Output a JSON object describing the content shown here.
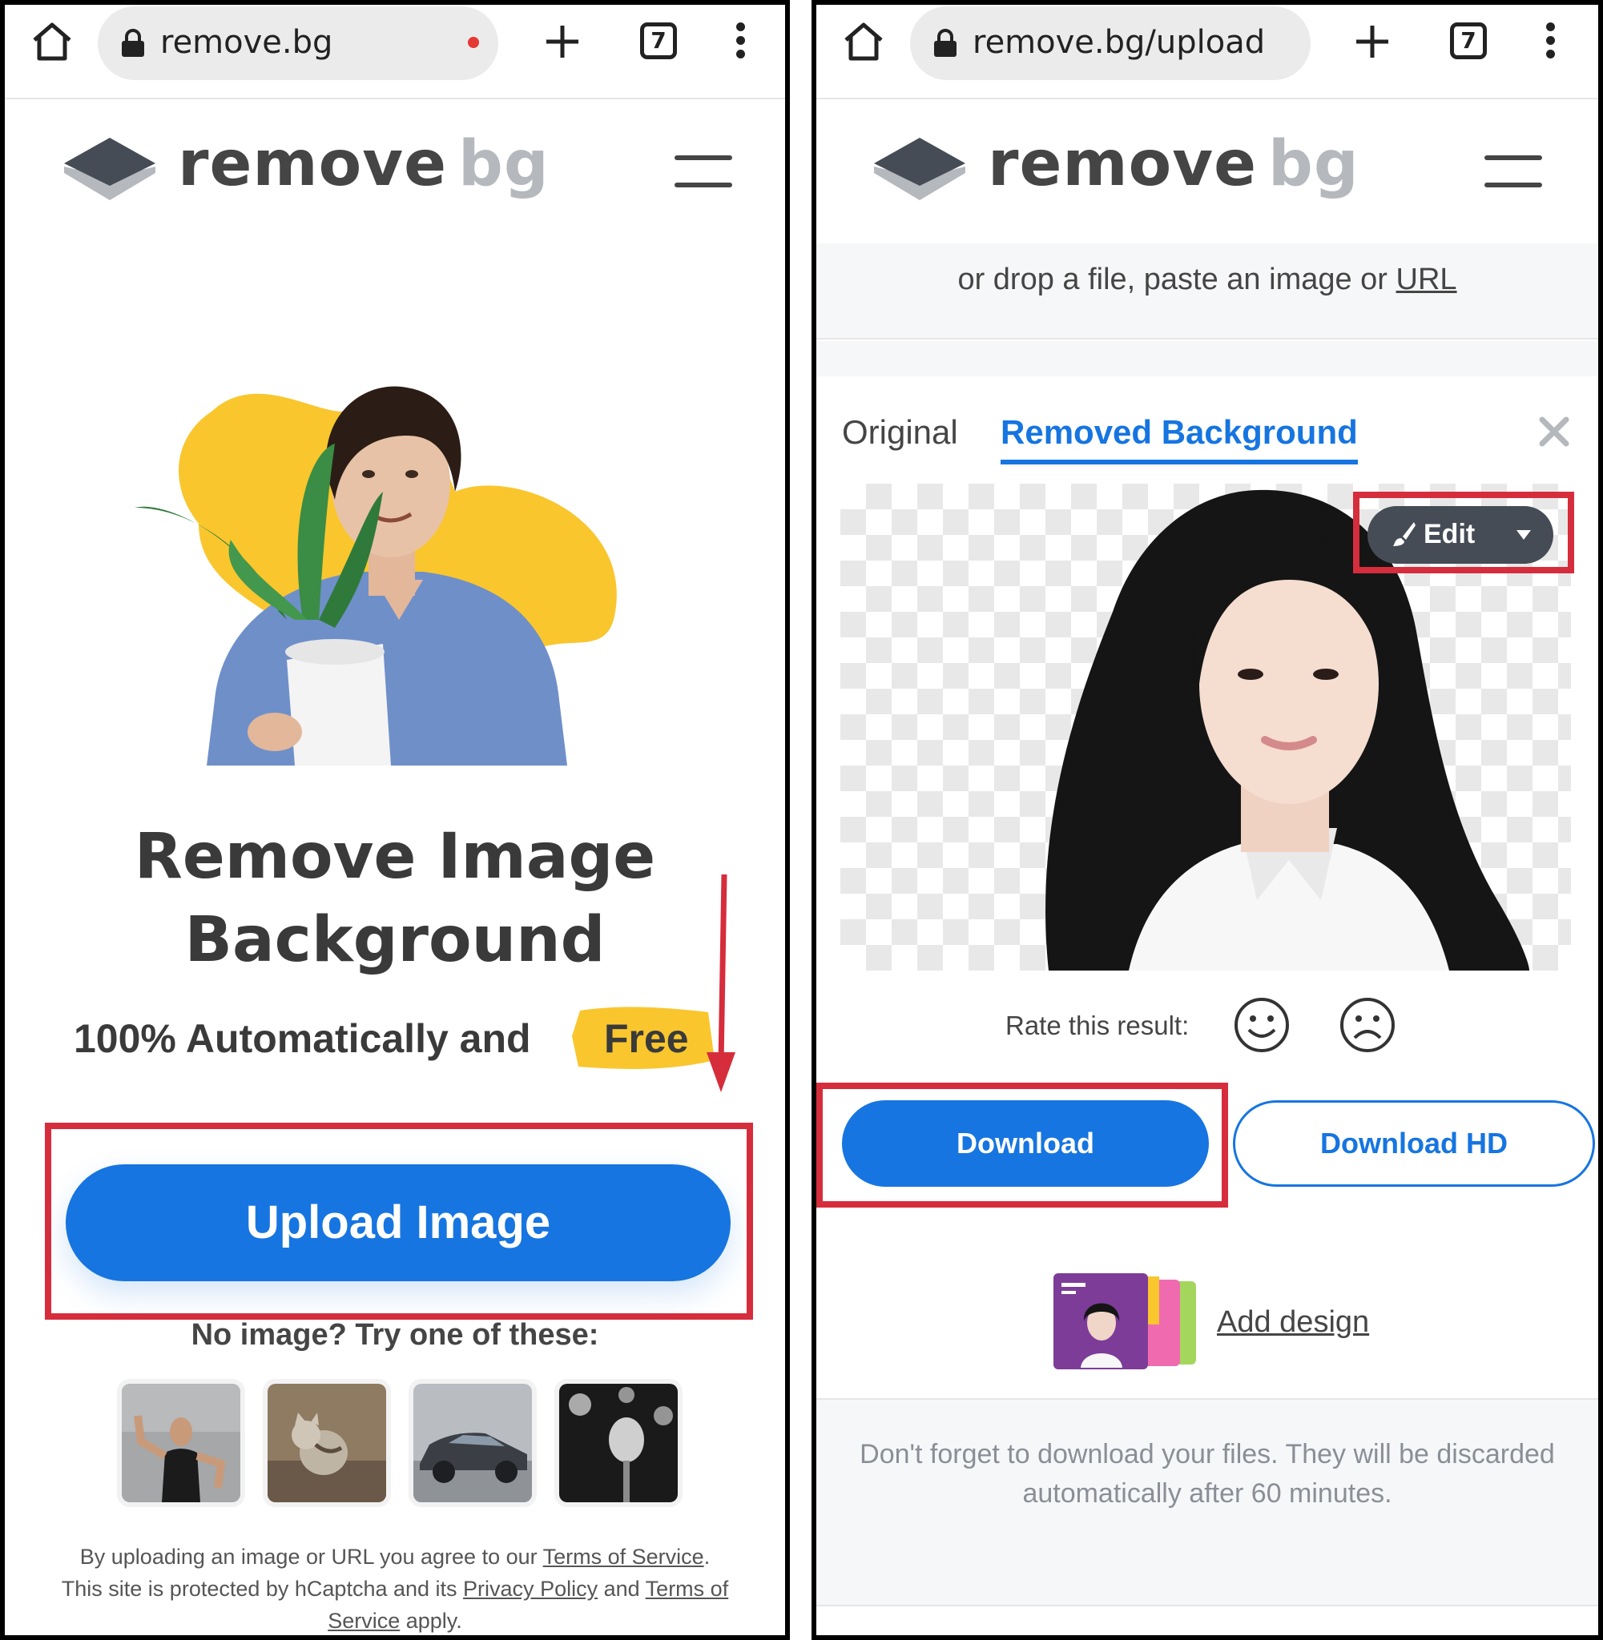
{
  "left_screen": {
    "browser": {
      "url": "remove.bg",
      "tab_count": "7"
    },
    "logo": {
      "word1": "remove",
      "word2": "bg"
    },
    "hero": {
      "title_line1": "Remove Image",
      "title_line2": "Background",
      "tagline": "100% Automatically and",
      "tagline_highlight": "Free"
    },
    "upload_button": "Upload Image",
    "samples": {
      "prompt": "No image? Try one of these:",
      "items": [
        "woman",
        "cat",
        "car",
        "microphone"
      ]
    },
    "legal": {
      "part1": "By uploading an image or URL you agree to our ",
      "tos_link": "Terms of Service",
      "part2": ".",
      "part3": "This site is protected by hCaptcha and its ",
      "privacy_link": "Privacy Policy",
      "part4": " and ",
      "terms_link": "Terms of Service",
      "part5": " apply."
    }
  },
  "right_screen": {
    "browser": {
      "url": "remove.bg/upload",
      "tab_count": "7"
    },
    "logo": {
      "word1": "remove",
      "word2": "bg"
    },
    "drop_prompt": "or drop a file, paste an image or ",
    "drop_url_link": "URL",
    "tabs": {
      "original": "Original",
      "removed": "Removed Background"
    },
    "edit_button": "Edit",
    "rate_label": "Rate this result:",
    "download_button": "Download",
    "download_hd_button": "Download HD",
    "add_design_link": "Add design",
    "notice": "Don't forget to download your files. They will be discarded automatically after 60 minutes."
  },
  "colors": {
    "primary_blue": "#1675e0",
    "highlight_red": "#d62d3c",
    "accent_yellow": "#f9c62e",
    "text_dark": "#454545"
  },
  "icons": [
    "home-icon",
    "lock-icon",
    "plus-icon",
    "tabs-icon",
    "kebab-icon",
    "hamburger-icon",
    "close-icon",
    "brush-icon",
    "caret-down-icon",
    "smile-icon",
    "frown-icon",
    "red-arrow"
  ]
}
